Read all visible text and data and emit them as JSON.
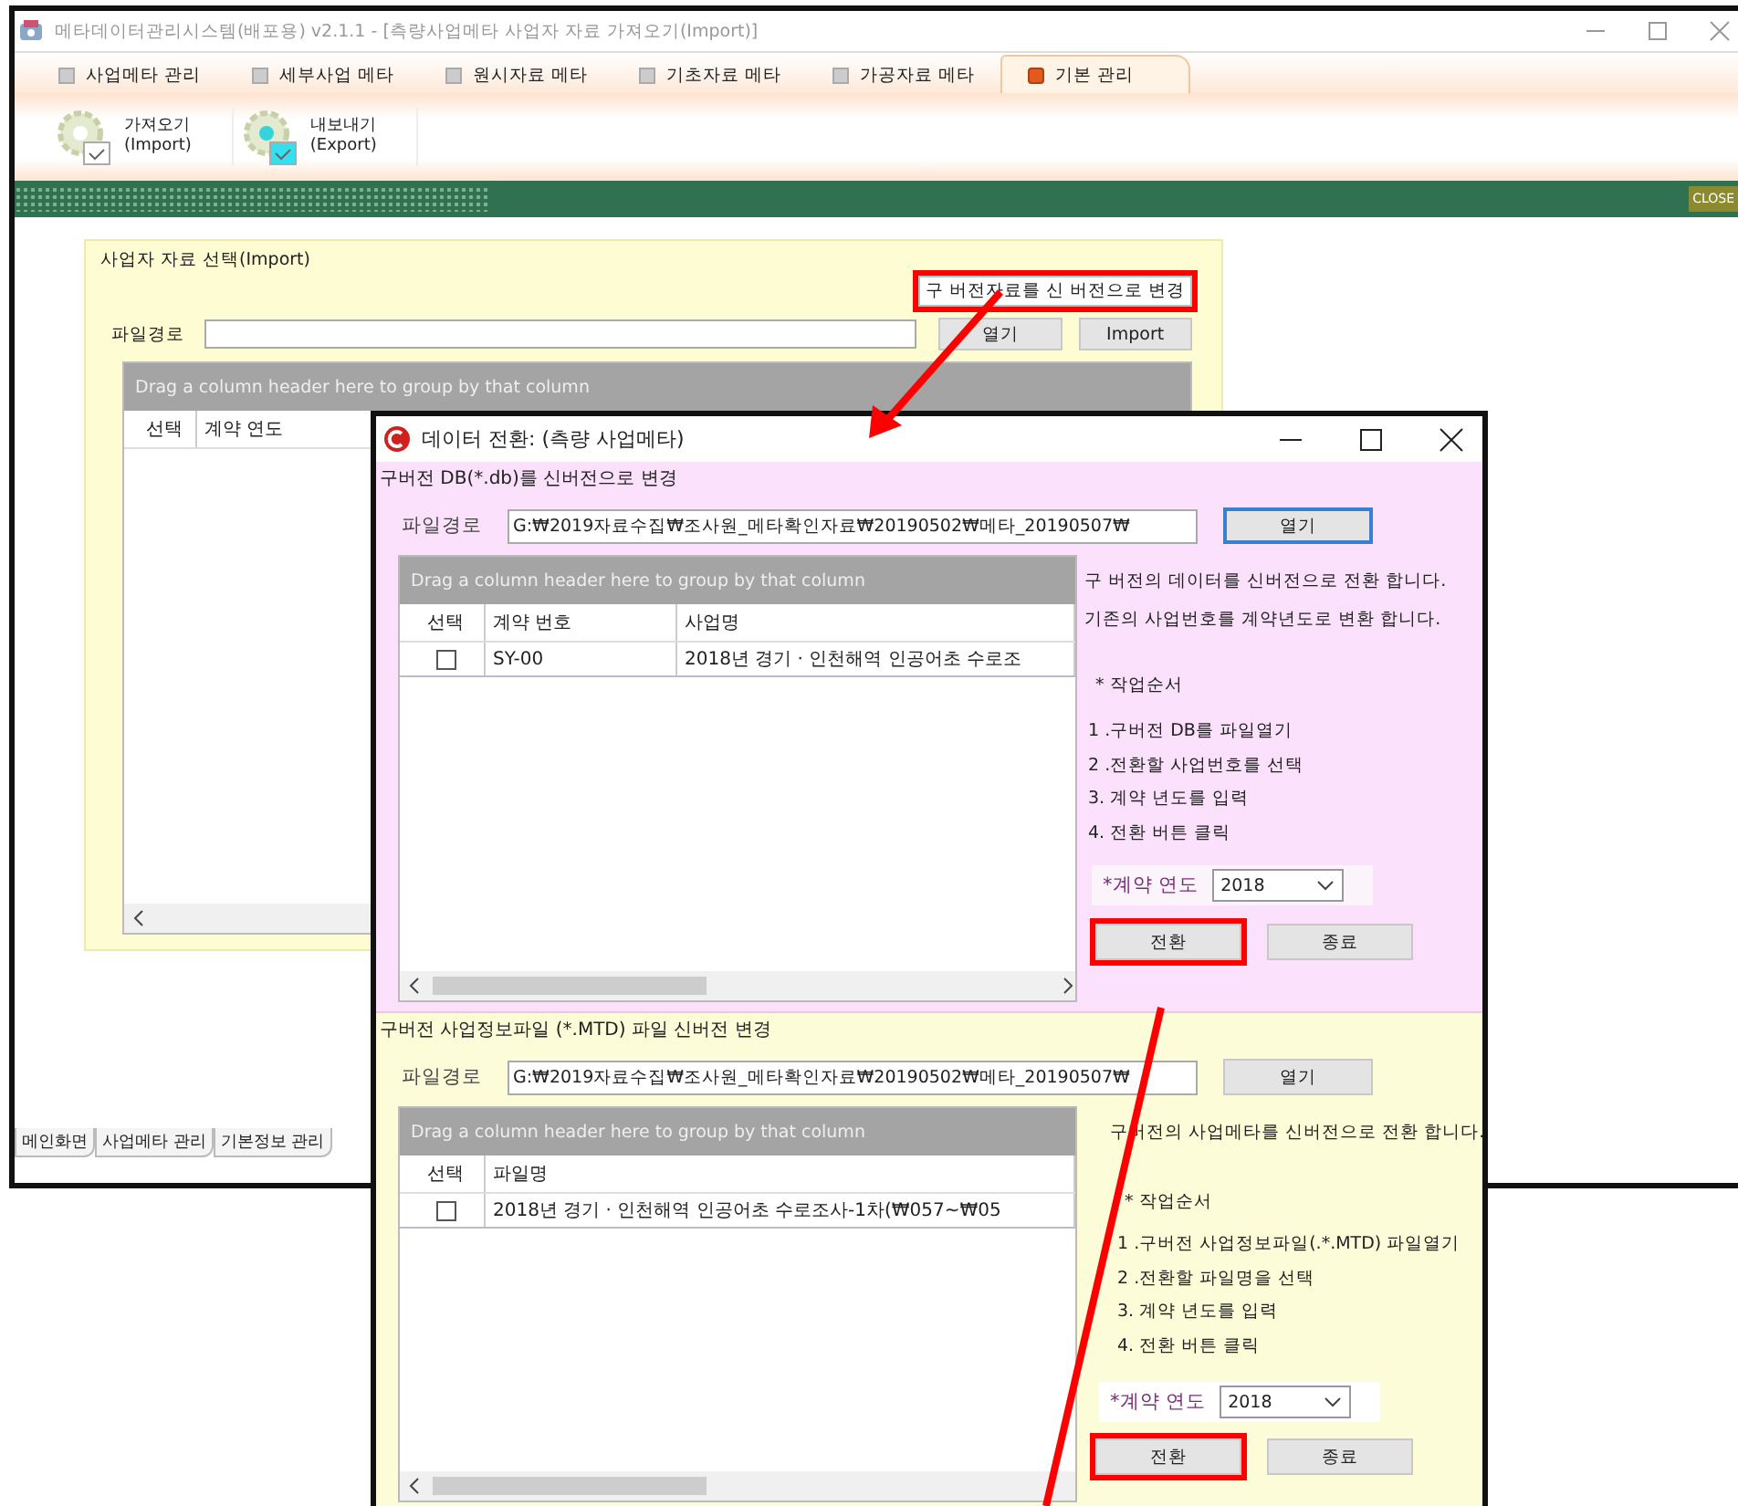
{
  "window": {
    "title": "메타데이터관리시스템(배포용) v2.1.1 - [측량사업메타 사업자 자료 가져오기(Import)]"
  },
  "menu_tabs": [
    {
      "label": "사업메타 관리",
      "selected": false
    },
    {
      "label": "세부사업 메타",
      "selected": false
    },
    {
      "label": "원시자료 메타",
      "selected": false
    },
    {
      "label": "기초자료 메타",
      "selected": false
    },
    {
      "label": "가공자료 메타",
      "selected": false
    },
    {
      "label": "기본 관리",
      "selected": true
    }
  ],
  "ribbon": [
    {
      "label": "가져오기",
      "sublabel": "(Import)",
      "kind": "import"
    },
    {
      "label": "내보내기",
      "sublabel": "(Export)",
      "kind": "export"
    }
  ],
  "close_label": "CLOSE",
  "import_group": {
    "title": "사업자 자료 선택(Import)",
    "convert_button": {
      "label": "구 버전자료를 신 버전으로 변경",
      "highlighted": true
    },
    "path_label": "파일경로",
    "open_button": "열기",
    "import_button": "Import",
    "grid": {
      "group_hint": "Drag a column header here to group by that column",
      "columns": [
        "선택",
        "계약 연도"
      ]
    }
  },
  "bottom_tabs": [
    {
      "label": "메인화면",
      "selected": false
    },
    {
      "label": "사업메타 관리",
      "selected": false
    },
    {
      "label": "기본정보 관리",
      "selected": false
    }
  ],
  "dialog": {
    "title": "데이터 전환:  (측량 사업메타)",
    "sections": [
      {
        "heading": "구버전 DB(*.db)를 신버전으로 변경",
        "path_label": "파일경로",
        "path_value": "G:₩2019자료수집₩조사원_메타확인자료₩20190502₩메타_20190507₩",
        "open_button": {
          "label": "열기",
          "focused": true
        },
        "grid": {
          "group_hint": "Drag a column header here to group by that column",
          "columns": [
            "선택",
            "계약 번호",
            "사업명"
          ],
          "rows": [
            {
              "checked": false,
              "cells": [
                "",
                "SY-00",
                "2018년 경기 · 인천해역 인공어초 수로조"
              ]
            }
          ]
        },
        "notes": [
          "구 버전의 데이터를 신버전으로 전환 합니다.",
          "기존의 사업번호를 계약년도로 변환 합니다."
        ],
        "steps_title": "* 작업순서",
        "steps": [
          "1 .구버전 DB를 파일열기",
          "2 .전환할 사업번호를 선택",
          "3. 계약 년도를 입력",
          "4. 전환 버튼 클릭"
        ],
        "year_label": "*계약  연도",
        "year_value": "2018",
        "convert_button": {
          "label": "전환",
          "highlighted": true
        },
        "exit_button": "종료"
      },
      {
        "heading": "구버전 사업정보파일 (*.MTD) 파일 신버전 변경",
        "path_label": "파일경로",
        "path_value": "G:₩2019자료수집₩조사원_메타확인자료₩20190502₩메타_20190507₩",
        "open_button": {
          "label": "열기",
          "focused": false
        },
        "grid": {
          "group_hint": "Drag a column header here to group by that column",
          "columns": [
            "선택",
            "파일명"
          ],
          "rows": [
            {
              "checked": false,
              "cells": [
                "",
                "2018년 경기 · 인천해역 인공어초 수로조사-1차(₩057~₩05"
              ]
            }
          ]
        },
        "notes": [
          "구버전의 사업메타를 신버전으로 전환 합니다."
        ],
        "steps_title": "* 작업순서",
        "steps": [
          "1 .구버전 사업정보파일(.*.MTD) 파일열기",
          "2 .전환할 파일명을 선택",
          "3. 계약 년도를 입력",
          "4. 전환 버튼 클릭"
        ],
        "year_label": "*계약  연도",
        "year_value": "2018",
        "convert_button": {
          "label": "전환",
          "highlighted": true
        },
        "exit_button": "종료"
      }
    ]
  }
}
